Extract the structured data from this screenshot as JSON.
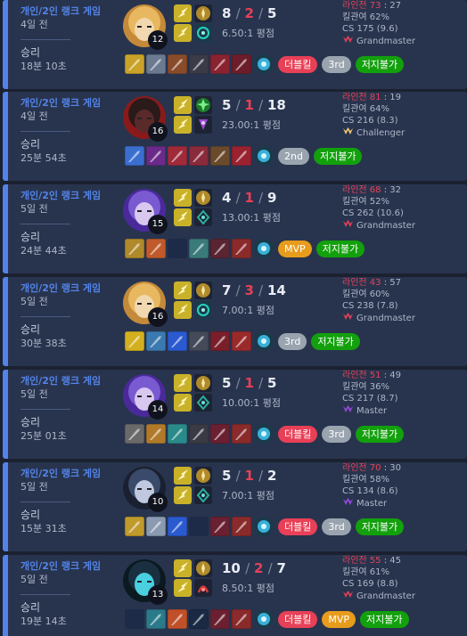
{
  "labels": {
    "lane": "라인전",
    "kp_prefix": "킬관여 ",
    "cs_prefix": "CS ",
    "ratio_suffix": " 평점"
  },
  "colors": {
    "accent": "#5383e8",
    "death": "#e84057",
    "double_kill": "#e84057",
    "mvp": "#e89c1c",
    "rank": "#9aa4af",
    "no_jungle": "#13a00d"
  },
  "matches": [
    {
      "queue": "개인/2인 랭크 게임",
      "date": "4일 전",
      "result": "승리",
      "duration": "18분 10초",
      "champion_icon": "champion-blonde-icon",
      "level": "12",
      "kills": "8",
      "deaths": "2",
      "assists": "5",
      "ratio": "6.50:1",
      "lane_a": "73",
      "lane_b": "27",
      "kill_participation": "62%",
      "cs": "175 (9.6)",
      "tier": "Grandmaster",
      "badges": [
        "더블킬",
        "3rd",
        "저지불가"
      ]
    },
    {
      "queue": "개인/2인 랭크 게임",
      "date": "4일 전",
      "result": "승리",
      "duration": "25분 54초",
      "champion_icon": "champion-dark-icon",
      "level": "16",
      "kills": "5",
      "deaths": "1",
      "assists": "18",
      "ratio": "23.00:1",
      "lane_a": "81",
      "lane_b": "19",
      "kill_participation": "64%",
      "cs": "216 (8.3)",
      "tier": "Challenger",
      "badges": [
        "2nd",
        "저지불가"
      ]
    },
    {
      "queue": "개인/2인 랭크 게임",
      "date": "5일 전",
      "result": "승리",
      "duration": "24분 44초",
      "champion_icon": "champion-violet-icon",
      "level": "15",
      "kills": "4",
      "deaths": "1",
      "assists": "9",
      "ratio": "13.00:1",
      "lane_a": "68",
      "lane_b": "32",
      "kill_participation": "52%",
      "cs": "262 (10.6)",
      "tier": "Grandmaster",
      "badges": [
        "MVP",
        "저지불가"
      ]
    },
    {
      "queue": "개인/2인 랭크 게임",
      "date": "5일 전",
      "result": "승리",
      "duration": "30분 38초",
      "champion_icon": "champion-blonde-icon",
      "level": "16",
      "kills": "7",
      "deaths": "3",
      "assists": "14",
      "ratio": "7.00:1",
      "lane_a": "43",
      "lane_b": "57",
      "kill_participation": "60%",
      "cs": "238 (7.8)",
      "tier": "Grandmaster",
      "badges": [
        "3rd",
        "저지불가"
      ]
    },
    {
      "queue": "개인/2인 랭크 게임",
      "date": "5일 전",
      "result": "승리",
      "duration": "25분 01초",
      "champion_icon": "champion-violet-icon",
      "level": "14",
      "kills": "5",
      "deaths": "1",
      "assists": "5",
      "ratio": "10.00:1",
      "lane_a": "51",
      "lane_b": "49",
      "kill_participation": "36%",
      "cs": "217 (8.7)",
      "tier": "Master",
      "badges": [
        "더블킬",
        "3rd",
        "저지불가"
      ]
    },
    {
      "queue": "개인/2인 랭크 게임",
      "date": "5일 전",
      "result": "승리",
      "duration": "15분 31초",
      "champion_icon": "champion-hooded-icon",
      "level": "10",
      "kills": "5",
      "deaths": "1",
      "assists": "2",
      "ratio": "7.00:1",
      "lane_a": "70",
      "lane_b": "30",
      "kill_participation": "58%",
      "cs": "134 (8.6)",
      "tier": "Master",
      "badges": [
        "더블킬",
        "3rd",
        "저지불가"
      ]
    },
    {
      "queue": "개인/2인 랭크 게임",
      "date": "5일 전",
      "result": "승리",
      "duration": "19분 14초",
      "champion_icon": "champion-masked-icon",
      "level": "13",
      "kills": "10",
      "deaths": "2",
      "assists": "7",
      "ratio": "8.50:1",
      "lane_a": "55",
      "lane_b": "45",
      "kill_participation": "61%",
      "cs": "169 (8.8)",
      "tier": "Grandmaster",
      "badges": [
        "더블킬",
        "MVP",
        "저지불가"
      ]
    }
  ]
}
